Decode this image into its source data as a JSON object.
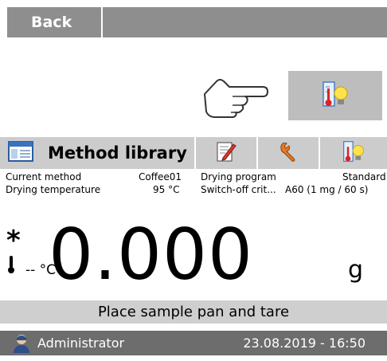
{
  "topbar": {
    "back_label": "Back"
  },
  "toolbar": {
    "method_library_label": "Method library"
  },
  "info": {
    "current_method_label": "Current method",
    "current_method_value": "Coffee01",
    "drying_temperature_label": "Drying temperature",
    "drying_temperature_value": "95 °C",
    "drying_program_label": "Drying program",
    "drying_program_value": "Standard",
    "switch_off_label": "Switch-off crit...",
    "switch_off_value": "A60  (1 mg / 60 s)"
  },
  "display": {
    "asterisk": "*",
    "temperature": "-- °C",
    "weight": "0.000",
    "unit": "g"
  },
  "status": {
    "message": "Place sample pan and tare"
  },
  "footer": {
    "user": "Administrator",
    "datetime": "23.08.2019 - 16:50"
  },
  "icons": {
    "hand": "hand-pointer-icon",
    "quick": "thermometer-bulb-icon",
    "library": "window-icon",
    "edit": "pencil-edit-icon",
    "tools": "wrench-icon"
  },
  "colors": {
    "bar_gray": "#8e8e8e",
    "toolbar_gray": "#cccccc",
    "footer_gray": "#6d6d6d"
  }
}
